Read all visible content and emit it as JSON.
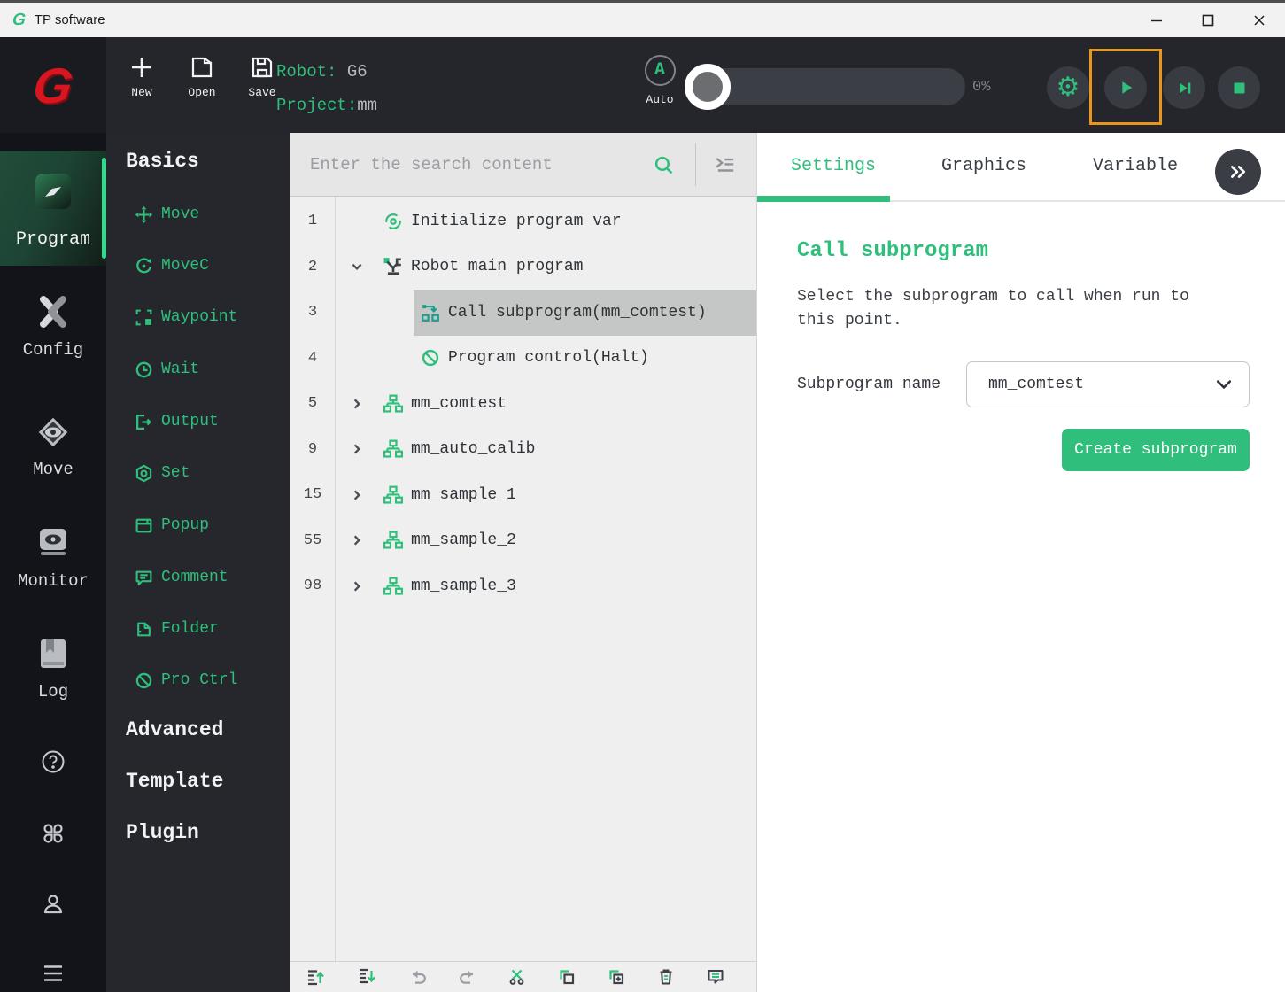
{
  "colors": {
    "accent": "#2fbe7b",
    "logo_red": "#d8161f",
    "highlight_orange": "#e8961e",
    "call_icon_teal": "#1c9e8c",
    "header_bg": "#24262b",
    "sidebar_bg": "#131419",
    "palette_bg": "#25272d"
  },
  "window": {
    "title": "TP software"
  },
  "header": {
    "actions": [
      {
        "label": "New",
        "icon": "new-plus-icon"
      },
      {
        "label": "Open",
        "icon": "open-file-icon"
      },
      {
        "label": "Save",
        "icon": "save-icon"
      }
    ],
    "robot": {
      "label": "Robot:",
      "value": "G6"
    },
    "project": {
      "label": "Project:",
      "value": "mm"
    },
    "mode": {
      "letter": "A",
      "label": "Auto"
    },
    "speed": {
      "value": "0%"
    },
    "run_controls": [
      "settings-gear-icon",
      "play-icon",
      "step-icon",
      "stop-icon"
    ]
  },
  "sidebar": {
    "items": [
      {
        "label": "Program",
        "icon": "program-icon",
        "active": true
      },
      {
        "label": "Config",
        "icon": "config-icon"
      },
      {
        "label": "Move",
        "icon": "move-icon"
      },
      {
        "label": "Monitor",
        "icon": "monitor-icon"
      },
      {
        "label": "Log",
        "icon": "log-icon"
      }
    ],
    "footer_icons": [
      "help-icon",
      "apps-icon",
      "user-icon",
      "menu-icon"
    ]
  },
  "palette": {
    "section_title": "Basics",
    "items": [
      {
        "label": "Move",
        "icon": "move-cross-icon"
      },
      {
        "label": "MoveC",
        "icon": "move-circular-icon"
      },
      {
        "label": "Waypoint",
        "icon": "waypoint-icon"
      },
      {
        "label": "Wait",
        "icon": "wait-clock-icon"
      },
      {
        "label": "Output",
        "icon": "output-icon"
      },
      {
        "label": "Set",
        "icon": "set-icon"
      },
      {
        "label": "Popup",
        "icon": "popup-icon"
      },
      {
        "label": "Comment",
        "icon": "comment-icon"
      },
      {
        "label": "Folder",
        "icon": "folder-icon"
      },
      {
        "label": "Pro Ctrl",
        "icon": "program-control-icon"
      }
    ],
    "sections": [
      "Advanced",
      "Template",
      "Plugin"
    ]
  },
  "editor": {
    "search_placeholder": "Enter the search content",
    "rows": [
      {
        "line": "1",
        "label": "Initialize program var",
        "icon": "initialize-icon"
      },
      {
        "line": "2",
        "label": "Robot main program",
        "icon": "robot-icon",
        "chevron": "down"
      },
      {
        "line": "3",
        "label": "Call subprogram(mm_comtest)",
        "icon": "call-subprogram-icon",
        "selected": true
      },
      {
        "line": "4",
        "label": "Program control(Halt)",
        "icon": "halt-icon"
      },
      {
        "line": "5",
        "label": "mm_comtest",
        "icon": "subprogram-icon",
        "chevron": "right"
      },
      {
        "line": "9",
        "label": "mm_auto_calib",
        "icon": "subprogram-icon",
        "chevron": "right"
      },
      {
        "line": "15",
        "label": "mm_sample_1",
        "icon": "subprogram-icon",
        "chevron": "right"
      },
      {
        "line": "55",
        "label": "mm_sample_2",
        "icon": "subprogram-icon",
        "chevron": "right"
      },
      {
        "line": "98",
        "label": "mm_sample_3",
        "icon": "subprogram-icon",
        "chevron": "right"
      }
    ],
    "toolbar_icons": [
      "insert-before-icon",
      "insert-after-icon",
      "undo-icon",
      "redo-icon",
      "cut-icon",
      "copy-icon",
      "paste-icon",
      "delete-icon",
      "comment-icon"
    ]
  },
  "inspector": {
    "tabs": [
      {
        "label": "Settings",
        "active": true
      },
      {
        "label": "Graphics"
      },
      {
        "label": "Variable"
      }
    ],
    "heading": "Call subprogram",
    "description": "Select the subprogram to call when run to this point.",
    "field": {
      "label": "Subprogram name",
      "value": "mm_comtest"
    },
    "create_button": "Create subprogram"
  }
}
